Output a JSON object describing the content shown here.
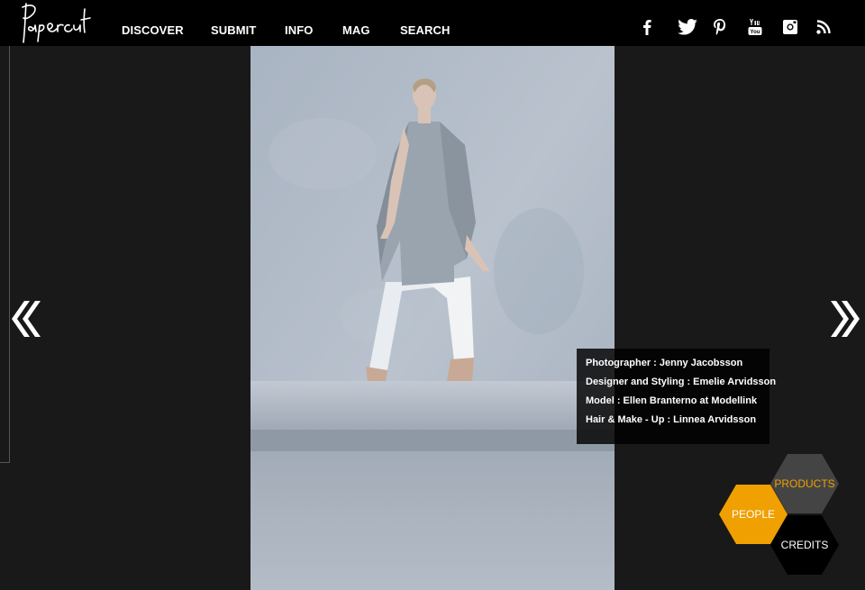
{
  "brand": {
    "logo_text": "Papercut"
  },
  "nav": [
    {
      "label": "DISCOVER"
    },
    {
      "label": "SUBMIT"
    },
    {
      "label": "INFO"
    },
    {
      "label": "MAG"
    },
    {
      "label": "SEARCH"
    }
  ],
  "social": [
    "facebook-icon",
    "twitter-icon",
    "pinterest-icon",
    "youtube-icon",
    "instagram-icon",
    "rss-icon"
  ],
  "gallery": {
    "prev_glyph": "«",
    "next_glyph": "»"
  },
  "credits": {
    "lines": [
      "Photographer : Jenny Jacobsson",
      "Designer and Styling : Emelie Arvidsson",
      "Model : Ellen Branterno at Modellink",
      "Hair & Make - Up : Linnea Arvidsson"
    ]
  },
  "tabs": {
    "products": "PRODUCTS",
    "people": "PEOPLE",
    "credits": "CREDITS"
  },
  "colors": {
    "accent": "#f0a000",
    "background": "#191919",
    "topbar": "#000000"
  }
}
